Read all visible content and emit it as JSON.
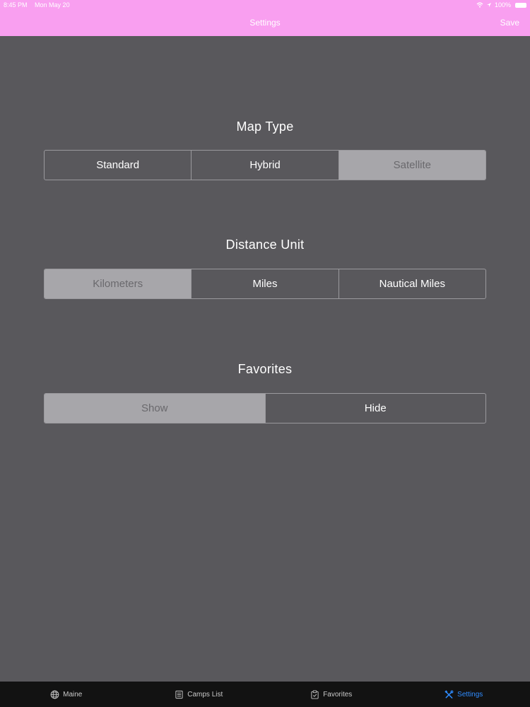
{
  "status": {
    "time": "8:45 PM",
    "date": "Mon May 20",
    "battery": "100%"
  },
  "nav": {
    "title": "Settings",
    "save_label": "Save"
  },
  "sections": [
    {
      "title": "Map Type",
      "options": [
        "Standard",
        "Hybrid",
        "Satellite"
      ],
      "selected": "Satellite"
    },
    {
      "title": "Distance Unit",
      "options": [
        "Kilometers",
        "Miles",
        "Nautical Miles"
      ],
      "selected": "Kilometers"
    },
    {
      "title": "Favorites",
      "options": [
        "Show",
        "Hide"
      ],
      "selected": "Show"
    }
  ],
  "tabs": [
    {
      "label": "Maine",
      "icon": "globe-icon"
    },
    {
      "label": "Camps List",
      "icon": "list-icon"
    },
    {
      "label": "Favorites",
      "icon": "clipboard-icon"
    },
    {
      "label": "Settings",
      "icon": "tools-icon",
      "active": true
    }
  ],
  "colors": {
    "nav_bg": "#f99ff0",
    "content_bg": "#59585c",
    "selected_bg": "#a7a6aa",
    "tab_active": "#2f8cff",
    "tab_bar_bg": "#121212"
  }
}
